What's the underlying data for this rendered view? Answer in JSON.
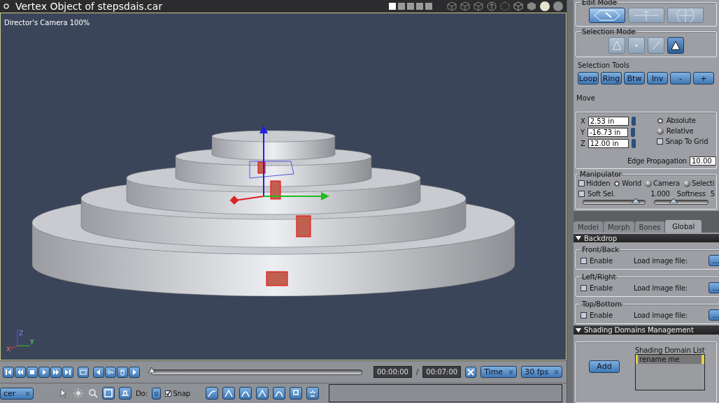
{
  "window": {
    "title": "Vertex Object of stepsdais.car"
  },
  "layout_buttons": [
    {
      "selected": true
    },
    {
      "selected": false
    },
    {
      "selected": false
    },
    {
      "selected": false
    },
    {
      "selected": false
    }
  ],
  "viewport": {
    "camera_label": "Director's Camera 100%",
    "axis_labels": [
      "Z",
      "Y",
      "X"
    ]
  },
  "edit_mode": {
    "title": "Edit Mode",
    "modes": [
      {
        "selected": true
      },
      {
        "selected": false
      },
      {
        "selected": false
      }
    ]
  },
  "selection_mode": {
    "title": "Selection Mode",
    "modes": [
      {
        "selected": false
      },
      {
        "selected": false
      },
      {
        "selected": false
      },
      {
        "selected": true
      }
    ]
  },
  "selection_tools": {
    "title": "Selection Tools",
    "buttons": [
      "Loop",
      "Ring",
      "Btw",
      "Inv",
      "-",
      "+"
    ]
  },
  "move": {
    "title": "Move",
    "fields": [
      {
        "axis": "X",
        "value": "2.53 in"
      },
      {
        "axis": "Y",
        "value": "-16.73 in"
      },
      {
        "axis": "Z",
        "value": "12.00 in"
      }
    ],
    "modes": [
      {
        "label": "Absolute",
        "selected": true
      },
      {
        "label": "Relative",
        "selected": false
      }
    ],
    "snap_to_grid": {
      "label": "Snap To Grid",
      "checked": false
    },
    "edge_propagation": {
      "label": "Edge Propagation",
      "value": "10.00"
    }
  },
  "manipulator": {
    "title": "Manipulator",
    "hidden": {
      "label": "Hidden",
      "checked": false
    },
    "spaces": [
      {
        "label": "World",
        "selected": true
      },
      {
        "label": "Camera",
        "selected": false
      },
      {
        "label": "Selecti",
        "selected": false
      }
    ],
    "soft_sel": {
      "label": "Soft Sel.",
      "checked": false,
      "value": "1.000",
      "level": 0.85
    },
    "softness": {
      "label": "Softness",
      "value": "5",
      "level": 0.35
    }
  },
  "tabs": [
    {
      "label": "Model",
      "selected": false
    },
    {
      "label": "Morph",
      "selected": false
    },
    {
      "label": "Bones",
      "selected": false
    },
    {
      "label": "Global",
      "selected": true
    }
  ],
  "backdrop": {
    "title": "Backdrop",
    "expanded": true,
    "groups": [
      {
        "title": "Front/Back",
        "enable": {
          "label": "Enable",
          "checked": false
        },
        "load_label": "Load image file:",
        "button": "..."
      },
      {
        "title": "Left/Right",
        "enable": {
          "label": "Enable",
          "checked": false
        },
        "load_label": "Load image file:",
        "button": "..."
      },
      {
        "title": "Top/Bottom",
        "enable": {
          "label": "Enable",
          "checked": false
        },
        "load_label": "Load image file:",
        "button": "..."
      }
    ]
  },
  "shading_domains": {
    "title": "Shading Domains Management",
    "expanded": true,
    "add_button": "Add",
    "list_title": "Shading Domain List",
    "items": [
      {
        "label": "rename me",
        "selected": true
      }
    ]
  },
  "timeline": {
    "level": 0,
    "current_time": "00:00:00",
    "separator": "/",
    "total_time": "00:07:00",
    "time_mode": "Time",
    "fps": "30 fps"
  },
  "bottom_toolbar": {
    "dropdown": "cer",
    "do_label": "Do:",
    "snap": {
      "label": "Snap",
      "checked": true
    }
  }
}
